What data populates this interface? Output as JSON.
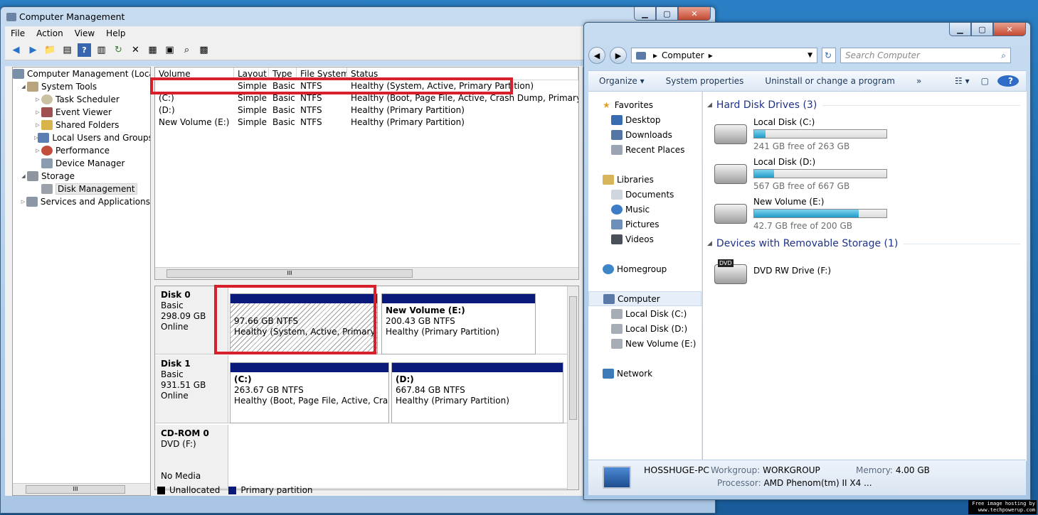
{
  "cm": {
    "title": "Computer Management",
    "menu": [
      "File",
      "Action",
      "View",
      "Help"
    ],
    "tree": [
      "Computer Management (Local",
      "System Tools",
      "Task Scheduler",
      "Event Viewer",
      "Shared Folders",
      "Local Users and Groups",
      "Performance",
      "Device Manager",
      "Storage",
      "Disk Management",
      "Services and Applications"
    ],
    "vol_headers": [
      "Volume",
      "Layout",
      "Type",
      "File System",
      "Status"
    ],
    "volumes": [
      {
        "vol": "",
        "layout": "Simple",
        "type": "Basic",
        "fs": "NTFS",
        "status": "Healthy (System, Active, Primary Partition)"
      },
      {
        "vol": "(C:)",
        "layout": "Simple",
        "type": "Basic",
        "fs": "NTFS",
        "status": "Healthy (Boot, Page File, Active, Crash Dump, Primary Partiti"
      },
      {
        "vol": "(D:)",
        "layout": "Simple",
        "type": "Basic",
        "fs": "NTFS",
        "status": "Healthy (Primary Partition)"
      },
      {
        "vol": "New Volume (E:)",
        "layout": "Simple",
        "type": "Basic",
        "fs": "NTFS",
        "status": "Healthy (Primary Partition)"
      }
    ],
    "disk0": {
      "name": "Disk 0",
      "type": "Basic",
      "size": "298.09 GB",
      "state": "Online",
      "p1": {
        "name": "",
        "size": "97.66 GB NTFS",
        "status": "Healthy (System, Active, Primary Par"
      },
      "p2": {
        "name": "New Volume  (E:)",
        "size": "200.43 GB NTFS",
        "status": "Healthy (Primary Partition)"
      }
    },
    "disk1": {
      "name": "Disk 1",
      "type": "Basic",
      "size": "931.51 GB",
      "state": "Online",
      "p1": {
        "name": "(C:)",
        "size": "263.67 GB NTFS",
        "status": "Healthy (Boot, Page File, Active, Crash D"
      },
      "p2": {
        "name": "(D:)",
        "size": "667.84 GB NTFS",
        "status": "Healthy (Primary Partition)"
      }
    },
    "cdrom": {
      "name": "CD-ROM 0",
      "type": "DVD (F:)",
      "state": "No Media"
    },
    "legend": {
      "unallocated": "Unallocated",
      "primary": "Primary partition"
    },
    "hscroll": "III"
  },
  "ex": {
    "address": "Computer",
    "search_placeholder": "Search Computer",
    "cmd": [
      "Organize ▾",
      "System properties",
      "Uninstall or change a program",
      "»"
    ],
    "nav": {
      "favorites": "Favorites",
      "desktop": "Desktop",
      "downloads": "Downloads",
      "recent": "Recent Places",
      "libraries": "Libraries",
      "documents": "Documents",
      "music": "Music",
      "pictures": "Pictures",
      "videos": "Videos",
      "homegroup": "Homegroup",
      "computer": "Computer",
      "c": "Local Disk (C:)",
      "d": "Local Disk (D:)",
      "e": "New Volume (E:)",
      "network": "Network"
    },
    "hdd_group": "Hard Disk Drives (3)",
    "drives": [
      {
        "name": "Local Disk (C:)",
        "free": "241 GB free of 263 GB",
        "used": 0.084
      },
      {
        "name": "Local Disk (D:)",
        "free": "567 GB free of 667 GB",
        "used": 0.15
      },
      {
        "name": "New Volume (E:)",
        "free": "42.7 GB free of 200 GB",
        "used": 0.79
      }
    ],
    "rem_group": "Devices with Removable Storage (1)",
    "dvd": {
      "name": "DVD RW Drive (F:)",
      "badge": "DVD"
    },
    "details": {
      "pc": "HOSSHUGE-PC",
      "wg_label": "Workgroup:",
      "wg": "WORKGROUP",
      "mem_label": "Memory:",
      "mem": "4.00 GB",
      "proc_label": "Processor:",
      "proc": "AMD Phenom(tm) II X4 ..."
    }
  },
  "credit": {
    "l1": "Free image hosting by",
    "l2": "www.techpowerup.com"
  }
}
